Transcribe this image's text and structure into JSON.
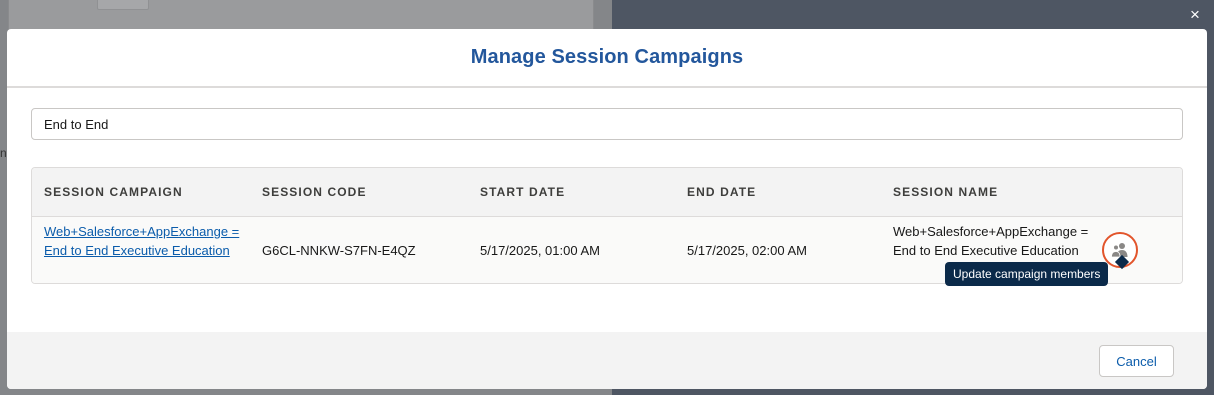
{
  "background_page": {
    "fragment_letter": "n"
  },
  "close_icon": "×",
  "modal": {
    "title": "Manage Session Campaigns",
    "search": {
      "value": "End to End",
      "placeholder": ""
    },
    "table": {
      "columns": [
        "SESSION CAMPAIGN",
        "SESSION CODE",
        "START DATE",
        "END DATE",
        "SESSION NAME"
      ],
      "rows": [
        {
          "session_campaign": "Web+Salesforce+AppExchange = End to End Executive Education",
          "session_code": "G6CL-NNKW-S7FN-E4QZ",
          "start_date": "5/17/2025, 01:00 AM",
          "end_date": "5/17/2025, 02:00 AM",
          "session_name": "Web+Salesforce+AppExchange = End to End Executive Education",
          "action_icon": "people-icon",
          "action_tooltip": "Update campaign members"
        }
      ]
    },
    "footer": {
      "cancel_label": "Cancel"
    }
  },
  "colors": {
    "title": "#23579c",
    "link": "#0b5cab",
    "focus_ring": "#e2552c",
    "tooltip_bg": "#0b2a4a"
  }
}
